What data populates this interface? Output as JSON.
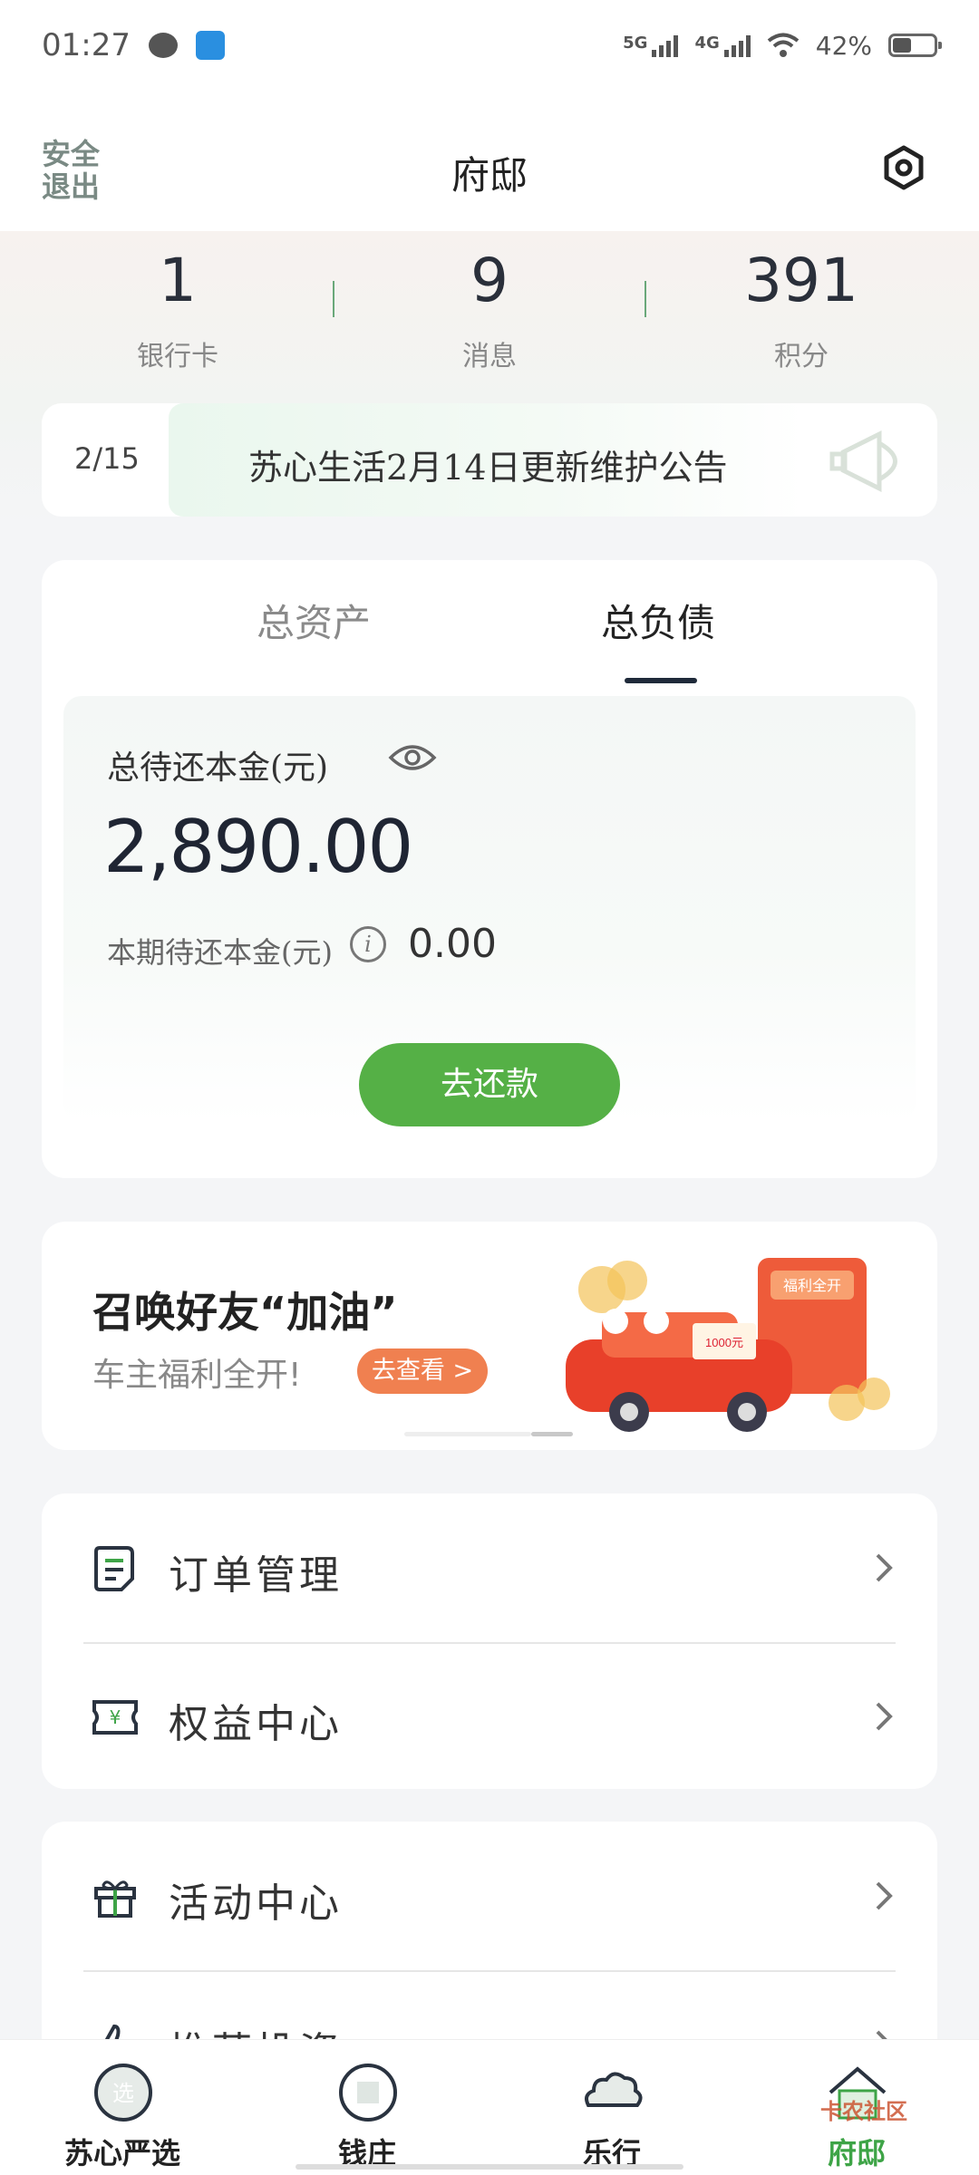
{
  "status_bar": {
    "time": "01:27",
    "network1": "5G",
    "network2": "4G",
    "battery": "42%"
  },
  "header": {
    "logout": "安全退出",
    "title": "府邸"
  },
  "stats": [
    {
      "value": "1",
      "label": "银行卡"
    },
    {
      "value": "9",
      "label": "消息"
    },
    {
      "value": "391",
      "label": "积分"
    }
  ],
  "notice": {
    "page": "2/15",
    "text": "苏心生活2月14日更新维护公告"
  },
  "finance": {
    "tabs": [
      "总资产",
      "总负债"
    ],
    "active_tab": "总负债",
    "total_label": "总待还本金(元)",
    "total_amount": "2,890.00",
    "period_label": "本期待还本金(元)",
    "period_amount": "0.00",
    "repay_button": "去还款"
  },
  "banner": {
    "title": "召唤好友“加油”",
    "subtitle": "车主福利全开!",
    "button": "去查看 >",
    "art_text1": "福利全开",
    "art_text2": "1000元"
  },
  "menu_group1": [
    {
      "label": "订单管理",
      "icon": "document-icon"
    },
    {
      "label": "权益中心",
      "icon": "ticket-icon"
    }
  ],
  "menu_group2": [
    {
      "label": "活动中心",
      "icon": "gift-icon"
    },
    {
      "label": "推荐投资",
      "icon": "thumb-icon"
    }
  ],
  "tabbar": [
    {
      "label": "苏心严选",
      "icon": "select-icon"
    },
    {
      "label": "钱庄",
      "icon": "coin-icon"
    },
    {
      "label": "乐行",
      "icon": "cloud-icon"
    },
    {
      "label": "府邸",
      "icon": "house-icon",
      "active": true
    }
  ],
  "watermark": "卡农社区",
  "colors": {
    "accent_green": "#55b046",
    "active_tab_green": "#3ea447",
    "banner_button": "#f08050"
  }
}
